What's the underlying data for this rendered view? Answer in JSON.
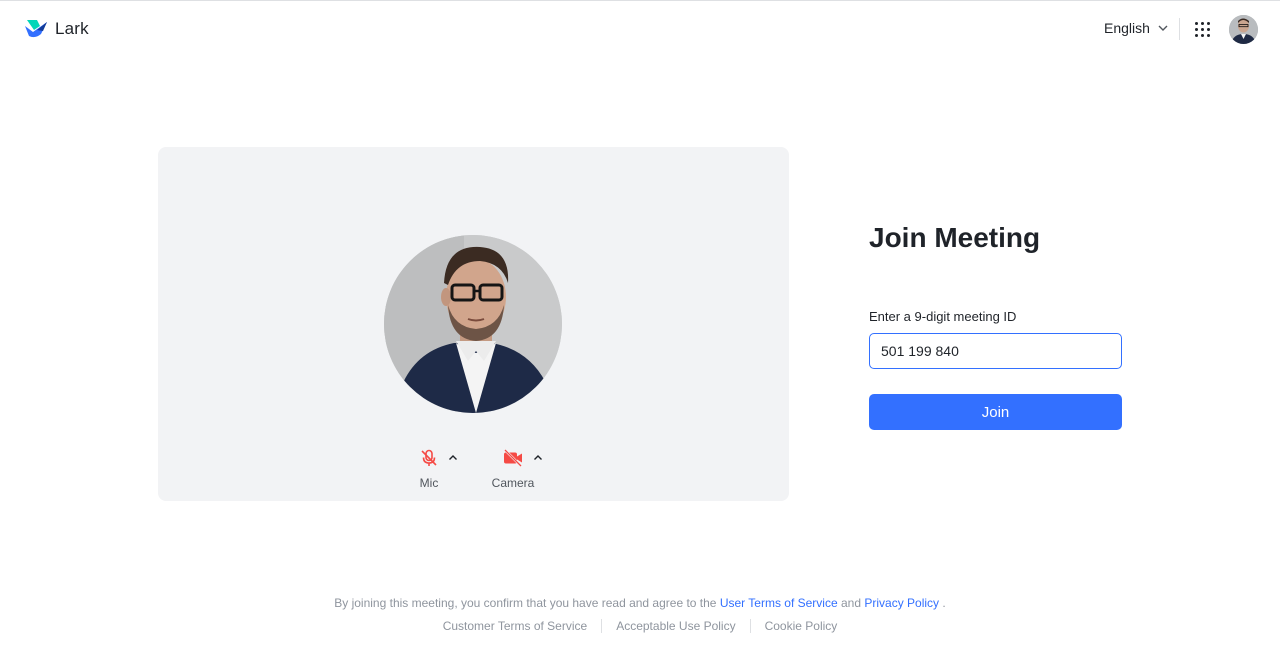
{
  "header": {
    "brand": "Lark",
    "language": "English"
  },
  "preview": {
    "mic_label": "Mic",
    "camera_label": "Camera",
    "mic_state": "muted",
    "camera_state": "off"
  },
  "join": {
    "title": "Join Meeting",
    "field_label": "Enter a 9-digit meeting ID",
    "meeting_id": "501 199 840",
    "button_label": "Join"
  },
  "footer": {
    "consent_prefix": "By joining this meeting, you confirm that you have read and agree to the",
    "user_terms": "User Terms of Service",
    "and": "and",
    "privacy": "Privacy Policy",
    "period": ".",
    "links": [
      "Customer Terms of Service",
      "Acceptable Use Policy",
      "Cookie Policy"
    ]
  },
  "colors": {
    "accent": "#3370ff",
    "muted_red": "#f54a45",
    "panel": "#f2f3f5"
  },
  "icons": [
    "lark-logo-icon",
    "chevron-down-icon",
    "apps-grid-icon",
    "mic-off-icon",
    "camera-off-icon",
    "caret-up-icon"
  ]
}
